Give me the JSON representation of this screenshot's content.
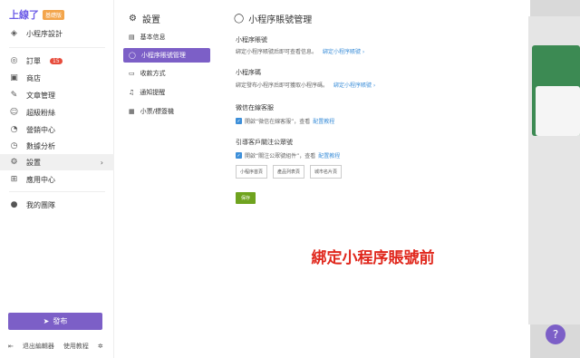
{
  "logo": {
    "text": "上線了",
    "badge": "基礎版"
  },
  "sidebar": {
    "items": [
      {
        "label": "小程序設計",
        "icon": "layers-icon"
      },
      {
        "label": "訂單",
        "icon": "order-icon",
        "badge": "15"
      },
      {
        "label": "商店",
        "icon": "store-icon"
      },
      {
        "label": "文章管理",
        "icon": "pen-icon"
      },
      {
        "label": "超級粉絲",
        "icon": "fans-icon"
      },
      {
        "label": "營銷中心",
        "icon": "megaphone-icon"
      },
      {
        "label": "數據分析",
        "icon": "chart-icon"
      },
      {
        "label": "設置",
        "icon": "gear-icon"
      },
      {
        "label": "應用中心",
        "icon": "apps-icon"
      },
      {
        "label": "我的團隊",
        "icon": "avatar-icon"
      }
    ],
    "publish": "發布",
    "bottom": {
      "exit": "退出編輯器",
      "tutorial": "使用教程"
    }
  },
  "settings_menu": {
    "title": "設置",
    "items": [
      {
        "label": "基本信息"
      },
      {
        "label": "小程序賬號管理"
      },
      {
        "label": "收款方式"
      },
      {
        "label": "通知提醒"
      },
      {
        "label": "小票/標簽機"
      }
    ]
  },
  "main": {
    "title": "小程序賬號管理",
    "account": {
      "heading": "小程序賬號",
      "desc": "綁定小程序賬號后即可查看信息。",
      "link": "綁定小程序賬號 ›"
    },
    "qrcode": {
      "heading": "小程序碼",
      "desc": "綁定發布小程序后即可獲取小程序碼。",
      "link": "綁定小程序賬號 ›"
    },
    "service": {
      "heading": "微信在線客服",
      "text": "開啟“微信在線客服”，查看",
      "link": "配置教程"
    },
    "follow": {
      "heading": "引導客戶關注公眾號",
      "text": "開啟“關注公眾號組件”，查看",
      "link": "配置教程"
    },
    "chips": [
      "小程序首頁",
      "產品列表頁",
      "城市名片頁"
    ],
    "save": "保存",
    "overlay": "綁定小程序賬號前"
  },
  "colors": {
    "accent": "#7c5fc7",
    "link": "#3d8fd9",
    "save": "#6fa31f",
    "overlay": "#e0271c"
  }
}
